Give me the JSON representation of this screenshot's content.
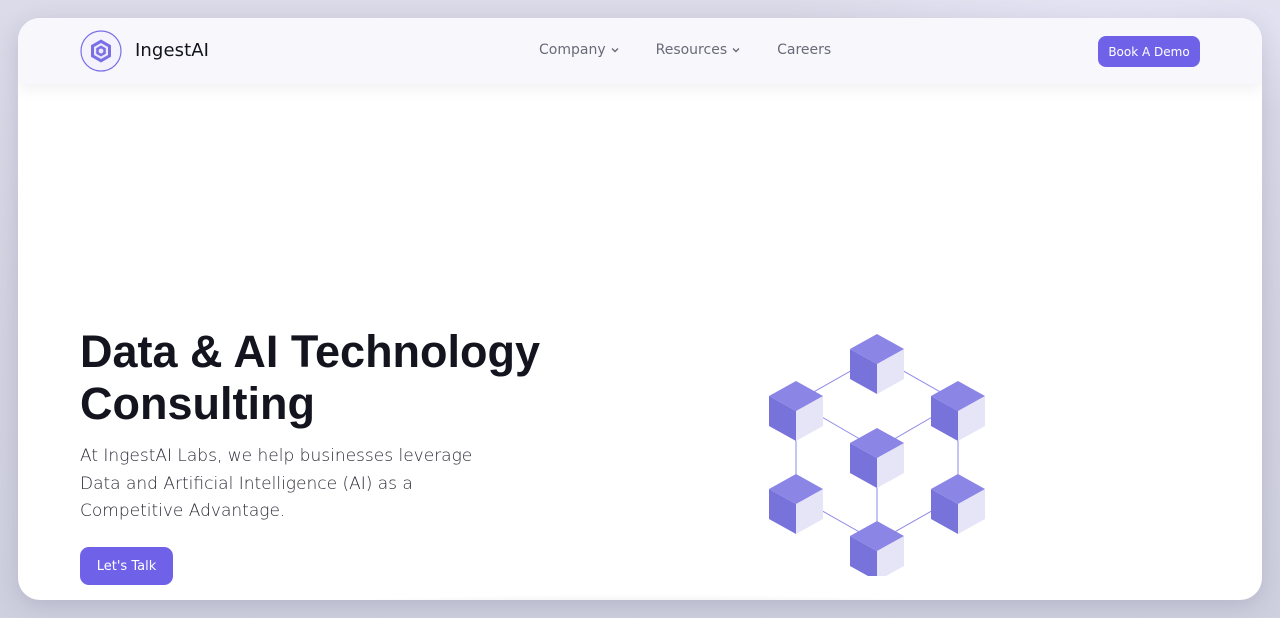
{
  "brand": {
    "name": "IngestAI",
    "logo_icon": "hexagon-logo-icon"
  },
  "nav": {
    "items": [
      {
        "label": "Company",
        "has_dropdown": true
      },
      {
        "label": "Resources",
        "has_dropdown": true
      },
      {
        "label": "Careers",
        "has_dropdown": false
      }
    ],
    "cta_label": "Book A Demo"
  },
  "hero": {
    "title_line1": "Data & AI Technology",
    "title_line2": "Consulting",
    "subtitle": "At IngestAI Labs, we help businesses leverage Data and Artificial Intelligence (AI) as a Competitive Advantage.",
    "cta_label": "Let's Talk",
    "illustration_icon": "cube-network-icon"
  },
  "colors": {
    "accent": "#6f62e8",
    "cube_top": "#8b85e6",
    "cube_left": "#7873db",
    "cube_right": "#e6e5f7",
    "text_dark": "#14141f"
  }
}
